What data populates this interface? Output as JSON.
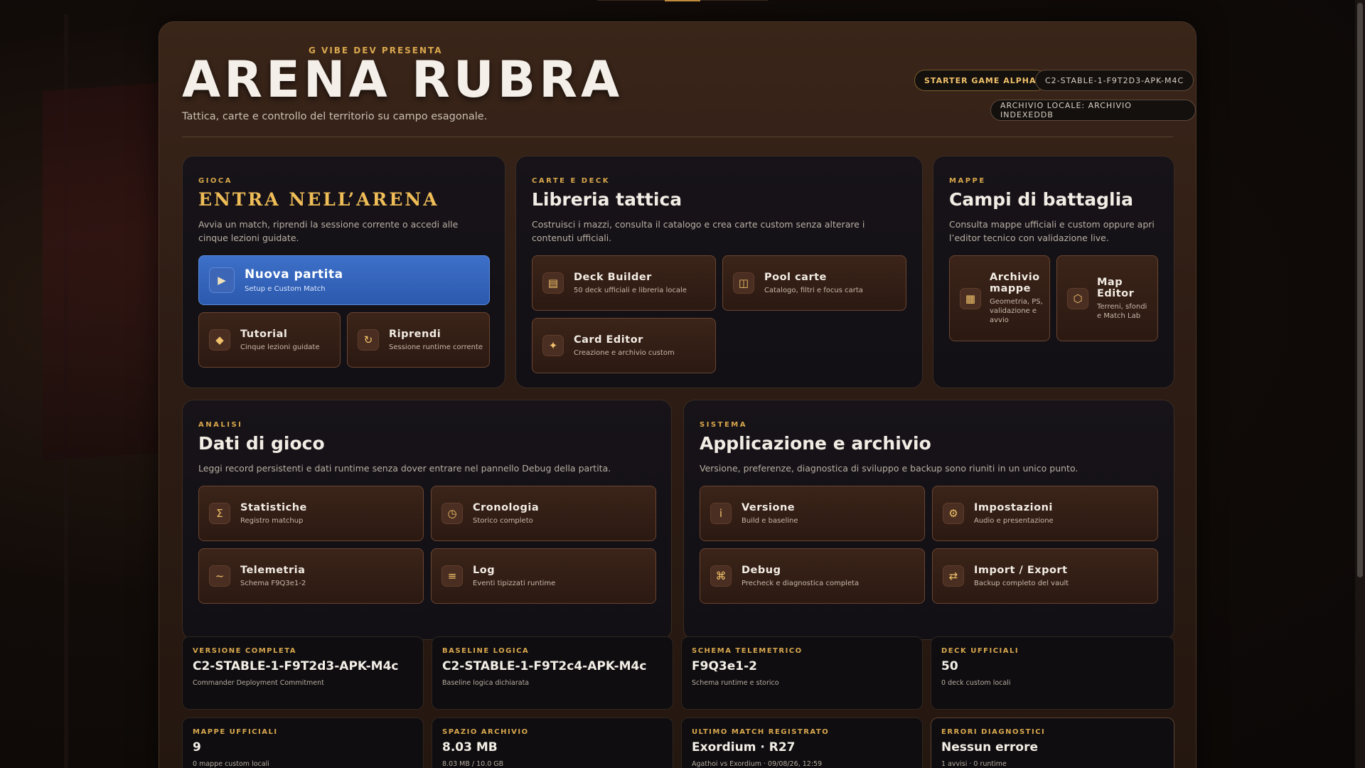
{
  "header": {
    "presenter": "G VIBE DEV PRESENTA",
    "title": "ARENA RUBRA",
    "subtitle": "Tattica, carte e controllo del territorio su campo esagonale.",
    "badges": [
      "STARTER GAME ALPHA",
      "C2-STABLE-1-F9T2D3-APK-M4C",
      "ARCHIVIO LOCALE: ARCHIVIO INDEXEDDB"
    ]
  },
  "play": {
    "kicker": "GIOCA",
    "title": "ENTRA NELL’ARENA",
    "desc": "Avvia un match, riprendi la sessione corrente o accedi alle cinque lezioni guidate.",
    "new_match": {
      "label": "Nuova partita",
      "sub": "Setup e Custom Match"
    },
    "tutorial": {
      "label": "Tutorial",
      "sub": "Cinque lezioni guidate"
    },
    "resume": {
      "label": "Riprendi",
      "sub": "Sessione runtime corrente"
    }
  },
  "cards": {
    "kicker": "CARTE E DECK",
    "title": "Libreria tattica",
    "desc": "Costruisci i mazzi, consulta il catalogo e crea carte custom senza alterare i contenuti ufficiali.",
    "deck_builder": {
      "label": "Deck Builder",
      "sub": "50 deck ufficiali e libreria locale"
    },
    "pool": {
      "label": "Pool carte",
      "sub": "Catalogo, filtri e focus carta"
    },
    "editor": {
      "label": "Card Editor",
      "sub": "Creazione e archivio custom"
    }
  },
  "maps": {
    "kicker": "MAPPE",
    "title": "Campi di battaglia",
    "desc": "Consulta mappe ufficiali e custom oppure apri l’editor tecnico con validazione live.",
    "archive": {
      "label": "Archivio mappe",
      "sub": "Geometria, PS, validazione e avvio"
    },
    "map_editor": {
      "label": "Map Editor",
      "sub": "Terreni, sfondi e Match Lab"
    }
  },
  "analysis": {
    "kicker": "ANALISI",
    "title": "Dati di gioco",
    "desc": "Leggi record persistenti e dati runtime senza dover entrare nel pannello Debug della partita.",
    "stats": {
      "label": "Statistiche",
      "sub": "Registro matchup"
    },
    "history": {
      "label": "Cronologia",
      "sub": "Storico completo"
    },
    "telemetry": {
      "label": "Telemetria",
      "sub": "Schema F9Q3e1-2"
    },
    "log": {
      "label": "Log",
      "sub": "Eventi tipizzati runtime"
    }
  },
  "system": {
    "kicker": "SISTEMA",
    "title": "Applicazione e archivio",
    "desc": "Versione, preferenze, diagnostica di sviluppo e backup sono riuniti in un unico punto.",
    "version": {
      "label": "Versione",
      "sub": "Build e baseline"
    },
    "settings": {
      "label": "Impostazioni",
      "sub": "Audio e presentazione"
    },
    "debug": {
      "label": "Debug",
      "sub": "Precheck e diagnostica completa"
    },
    "import_export": {
      "label": "Import / Export",
      "sub": "Backup completo del vault"
    }
  },
  "stats_row1": [
    {
      "k": "VERSIONE COMPLETA",
      "v": "C2-STABLE-1-F9T2d3-APK-M4c",
      "s": "Commander Deployment Commitment"
    },
    {
      "k": "BASELINE LOGICA",
      "v": "C2-STABLE-1-F9T2c4-APK-M4c",
      "s": "Baseline logica dichiarata"
    },
    {
      "k": "SCHEMA TELEMETRICO",
      "v": "F9Q3e1-2",
      "s": "Schema runtime e storico"
    },
    {
      "k": "DECK UFFICIALI",
      "v": "50",
      "s": "0 deck custom locali"
    }
  ],
  "stats_row2": [
    {
      "k": "MAPPE UFFICIALI",
      "v": "9",
      "s": "0 mappe custom locali"
    },
    {
      "k": "SPAZIO ARCHIVIO",
      "v": "8.03 MB",
      "s": "8.03 MB / 10.0 GB"
    },
    {
      "k": "ULTIMO MATCH REGISTRATO",
      "v": "Exordium · R27",
      "s": "Agathoi vs Exordium · 09/08/26, 12:59"
    },
    {
      "k": "ERRORI DIAGNOSTICI",
      "v": "Nessun errore",
      "s": "1 avvisi · 0 runtime"
    }
  ],
  "colors": {
    "accent_gold": "#d9a74c",
    "primary_blue": "#2f5fb5",
    "tile_brown": "#3b2419"
  }
}
